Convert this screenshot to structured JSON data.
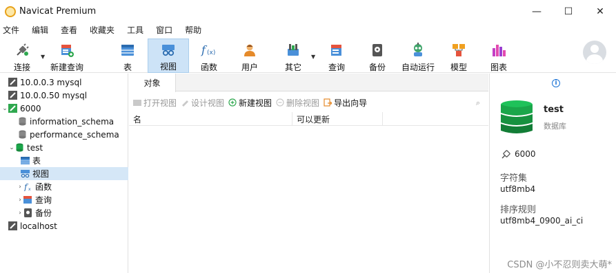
{
  "window": {
    "title": "Navicat Premium",
    "controls": {
      "minimize": "—",
      "maximize": "☐",
      "close": "✕"
    }
  },
  "menu": [
    "文件",
    "编辑",
    "查看",
    "收藏夹",
    "工具",
    "窗口",
    "帮助"
  ],
  "toolbar": {
    "items": [
      {
        "label": "连接",
        "icon": "plug-icon"
      },
      {
        "label": "新建查询",
        "icon": "new-query-icon"
      },
      {
        "label": "表",
        "icon": "table-icon"
      },
      {
        "label": "视图",
        "icon": "view-icon",
        "active": true
      },
      {
        "label": "函数",
        "icon": "function-icon"
      },
      {
        "label": "用户",
        "icon": "user-icon"
      },
      {
        "label": "其它",
        "icon": "tools-icon"
      },
      {
        "label": "查询",
        "icon": "query-icon"
      },
      {
        "label": "备份",
        "icon": "backup-icon"
      },
      {
        "label": "自动运行",
        "icon": "robot-icon"
      },
      {
        "label": "模型",
        "icon": "model-icon"
      },
      {
        "label": "图表",
        "icon": "chart-icon"
      }
    ]
  },
  "tree": {
    "items": [
      {
        "label": "10.0.0.3 mysql",
        "level": 0,
        "icon": "connection-icon"
      },
      {
        "label": "10.0.0.50 mysql",
        "level": 0,
        "icon": "connection-icon"
      },
      {
        "label": "6000",
        "level": 0,
        "icon": "connection-active-icon",
        "expanded": true
      },
      {
        "label": "information_schema",
        "level": 1,
        "icon": "database-icon"
      },
      {
        "label": "performance_schema",
        "level": 1,
        "icon": "database-icon"
      },
      {
        "label": "test",
        "level": 1,
        "icon": "database-active-icon",
        "expanded": true
      },
      {
        "label": "表",
        "level": 2,
        "icon": "table-icon"
      },
      {
        "label": "视图",
        "level": 2,
        "icon": "view-icon",
        "selected": true
      },
      {
        "label": "函数",
        "level": 2,
        "icon": "function-icon",
        "collapsed": true
      },
      {
        "label": "查询",
        "level": 2,
        "icon": "query-icon",
        "collapsed": true
      },
      {
        "label": "备份",
        "level": 2,
        "icon": "backup-icon",
        "collapsed": true
      },
      {
        "label": "localhost",
        "level": 0,
        "icon": "connection-icon"
      }
    ]
  },
  "center": {
    "tab": "对象",
    "actions": [
      {
        "label": "打开视图",
        "enabled": false,
        "icon": "open-view-icon"
      },
      {
        "label": "设计视图",
        "enabled": false,
        "icon": "design-view-icon"
      },
      {
        "label": "新建视图",
        "enabled": true,
        "icon": "new-view-icon"
      },
      {
        "label": "删除视图",
        "enabled": false,
        "icon": "delete-view-icon"
      },
      {
        "label": "导出向导",
        "enabled": true,
        "icon": "export-wizard-icon"
      }
    ],
    "columns": [
      "名",
      "可以更新"
    ]
  },
  "detail": {
    "name": "test",
    "type": "数据库",
    "connection": "6000",
    "charset_label": "字符集",
    "charset": "utf8mb4",
    "collation_label": "排序规则",
    "collation": "utf8mb4_0900_ai_ci"
  },
  "watermark": "CSDN @小不忍则卖大萌*",
  "colors": {
    "accent": "#1b73d6",
    "selection": "#d5e7f7",
    "db_green": "#1aa64a"
  }
}
